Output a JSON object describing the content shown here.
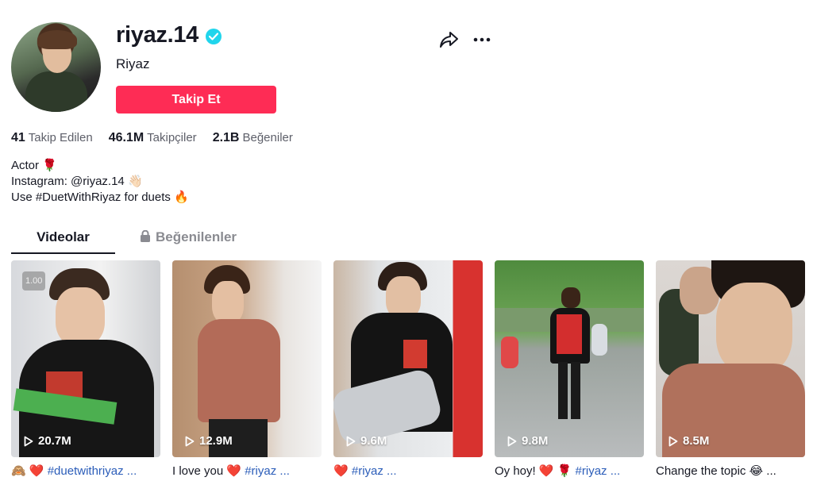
{
  "profile": {
    "username": "riyaz.14",
    "nickname": "Riyaz",
    "follow_label": "Takip Et"
  },
  "stats": [
    {
      "value": "41",
      "label": "Takip Edilen"
    },
    {
      "value": "46.1M",
      "label": "Takipçiler"
    },
    {
      "value": "2.1B",
      "label": "Beğeniler"
    }
  ],
  "bio": {
    "line1": "Actor 🌹",
    "line2": "Instagram: @riyaz.14 👋🏻",
    "line3": "Use #DuetWithRiyaz for duets 🔥"
  },
  "tabs": {
    "videos": "Videolar",
    "liked": "Beğenilenler"
  },
  "videos": [
    {
      "views": "20.7M",
      "badge": "1.00",
      "caption_prefix": "🙈 ❤️ ",
      "caption_tag": "#duetwithriyaz ..."
    },
    {
      "views": "12.9M",
      "caption_prefix": "I love you ❤️ ",
      "caption_tag": "#riyaz ..."
    },
    {
      "views": "9.6M",
      "caption_prefix": "❤️ ",
      "caption_tag": "#riyaz ..."
    },
    {
      "views": "9.8M",
      "caption_prefix": "Oy hoy! ❤️ 🌹 ",
      "caption_tag": "#riyaz ..."
    },
    {
      "views": "8.5M",
      "caption_prefix": "Change the topic 😂 ...",
      "caption_tag": ""
    }
  ],
  "colors": {
    "accent": "#fe2c55",
    "verified": "#20d5ec",
    "hashtag": "#2b5db9"
  },
  "icons": [
    "verified-icon",
    "share-icon",
    "more-icon",
    "lock-icon",
    "play-icon"
  ]
}
